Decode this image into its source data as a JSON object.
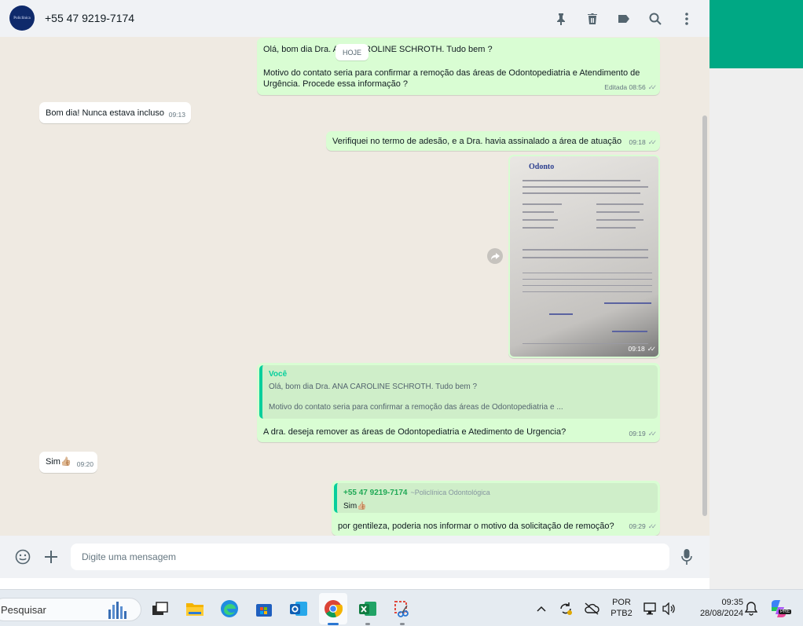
{
  "header": {
    "avatar_text": "Policlínica",
    "contact": "+55 47 9219-7174"
  },
  "chat": {
    "day_divider": "HOJE",
    "messages": [
      {
        "line1": "Olá, bom dia Dra. ANA CAROLINE SCHROTH. Tudo bem ?",
        "line2": "Motivo do contato seria para confirmar a remoção das áreas de Odontopediatria e Atendimento de",
        "line3": "Urgência. Procede essa informação ?",
        "time": "Editada 08:56"
      },
      {
        "text": "Bom dia! Nunca estava incluso",
        "time": "09:13"
      },
      {
        "text": "Verifiquei no termo de adesão, e a Dra. havia assinalado a área de atuação",
        "time": "09:18"
      },
      {
        "doc_brand": "Odonto",
        "time": "09:18"
      },
      {
        "quote_author": "Você",
        "quote_line1": "Olá, bom dia Dra. ANA CAROLINE SCHROTH. Tudo bem ?",
        "quote_line2": "Motivo do contato seria para confirmar a remoção das áreas de Odontopediatria e ...",
        "text": "A dra. deseja remover as áreas de Odontopediatria e Atedimento de Urgencia?",
        "time": "09:19"
      },
      {
        "text": "Sim👍🏼",
        "time": "09:20"
      },
      {
        "quote_author": "+55 47 9219-7174",
        "quote_sub": "~Policlínica Odontológica",
        "quote_text": "Sim👍🏼",
        "text": "por gentileza, poderia nos informar o motivo da solicitação de remoção?",
        "time": "09:29"
      }
    ]
  },
  "footer": {
    "placeholder": "Digite uma mensagem"
  },
  "taskbar": {
    "search_label": "Pesquisar",
    "lang_line1": "POR",
    "lang_line2": "PTB2",
    "time": "09:35",
    "date": "28/08/2024",
    "copilot_badge": "PRE"
  },
  "colors": {
    "out_bubble": "#d9fdd3",
    "in_bubble": "#ffffff",
    "chat_bg": "#efeae2",
    "accent": "#00a884",
    "quote_bar": "#06cf9c"
  }
}
